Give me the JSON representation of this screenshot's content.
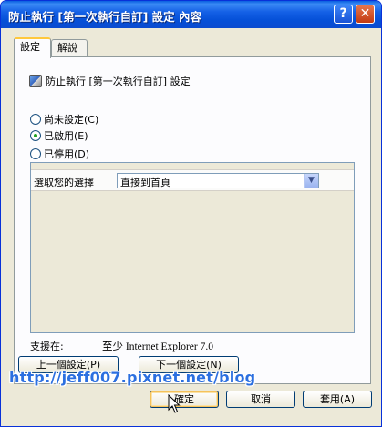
{
  "window": {
    "title": "防止執行 [第一次執行自訂] 設定 內容",
    "help_glyph": "?",
    "close_glyph": "✕"
  },
  "tabs": [
    {
      "label": "設定",
      "active": true
    },
    {
      "label": "解說",
      "active": false
    }
  ],
  "policy": {
    "icon": "policy-setting-icon",
    "title": "防止執行 [第一次執行自訂] 設定"
  },
  "radios": [
    {
      "label": "尚未設定(C)",
      "checked": false
    },
    {
      "label": "已啟用(E)",
      "checked": true
    },
    {
      "label": "已停用(D)",
      "checked": false
    }
  ],
  "options": {
    "label": "選取您的選擇",
    "selected": "直接到首頁"
  },
  "support": {
    "label": "支援在:",
    "value": "至少 Internet Explorer 7.0"
  },
  "nav_buttons": {
    "prev": "上一個設定(P)",
    "next": "下一個設定(N)"
  },
  "footer_buttons": {
    "ok": "確定",
    "cancel": "取消",
    "apply": "套用(A)"
  },
  "watermark": "http://jeff007.pixnet.net/blog"
}
